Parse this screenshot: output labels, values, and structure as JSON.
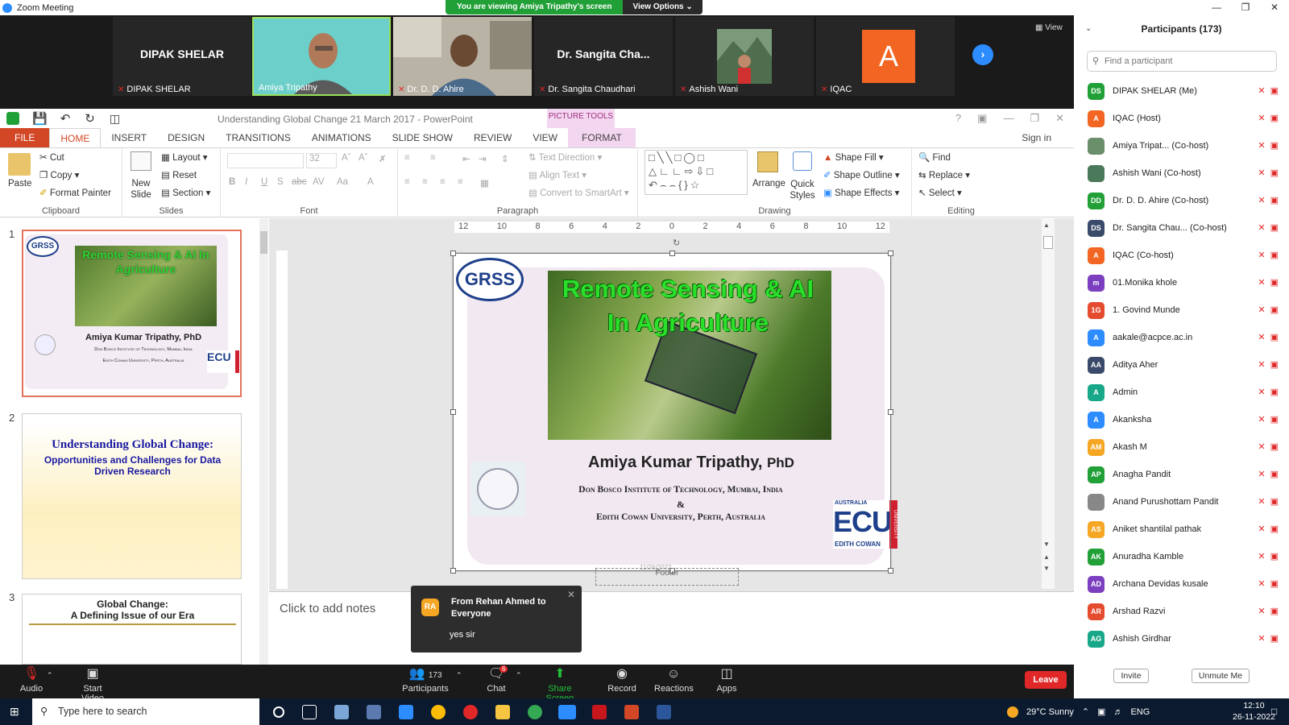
{
  "window": {
    "title": "Zoom Meeting"
  },
  "banner": {
    "message": "You are viewing Amiya Tripathy's screen",
    "view_options": "View Options ⌄"
  },
  "strip": {
    "tiles": [
      {
        "name": "DIPAK SHELAR",
        "display": "DIPAK SHELAR"
      },
      {
        "name": "Amiya  Tripathy"
      },
      {
        "name": "Dr. D. D. Ahire"
      },
      {
        "name": "Dr. Sangita Chaudhari",
        "display": "Dr. Sangita Cha..."
      },
      {
        "name": "Ashish Wani"
      },
      {
        "name": "IQAC",
        "initial": "A"
      }
    ],
    "view_label": "View"
  },
  "ppt": {
    "doc_title": "Understanding Global Change 21 March 2017 - PowerPoint",
    "picture_tools": "PICTURE TOOLS",
    "sign_in": "Sign in",
    "tabs": [
      "FILE",
      "HOME",
      "INSERT",
      "DESIGN",
      "TRANSITIONS",
      "ANIMATIONS",
      "SLIDE SHOW",
      "REVIEW",
      "VIEW",
      "FORMAT"
    ],
    "ribbon": {
      "clipboard": {
        "label": "Clipboard",
        "paste": "Paste",
        "cut": "Cut",
        "copy": "Copy",
        "format_painter": "Format Painter"
      },
      "slides": {
        "label": "Slides",
        "new_slide": "New Slide",
        "layout": "Layout",
        "reset": "Reset",
        "section": "Section"
      },
      "font": {
        "label": "Font",
        "size": "32"
      },
      "paragraph": {
        "label": "Paragraph",
        "text_direction": "Text Direction",
        "align_text": "Align Text",
        "convert": "Convert to SmartArt"
      },
      "drawing": {
        "label": "Drawing",
        "arrange": "Arrange",
        "quick_styles": "Quick Styles",
        "shape_fill": "Shape Fill",
        "shape_outline": "Shape Outline",
        "shape_effects": "Shape Effects"
      },
      "editing": {
        "label": "Editing",
        "find": "Find",
        "replace": "Replace",
        "select": "Select"
      }
    },
    "thumbs": [
      {
        "num": "1",
        "title": "Remote Sensing & AI In Agriculture",
        "author": "Amiya Kumar Tripathy, PhD",
        "inst1": "Don Bosco Institute of Technology, Mumbai, India",
        "inst2": "Edith Cowan University, Perth, Australia"
      },
      {
        "num": "2",
        "title": "Understanding Global Change:",
        "subtitle": "Opportunities and Challenges for Data Driven Research"
      },
      {
        "num": "3",
        "title": "Global Change:",
        "subtitle": "A Defining Issue of our Era"
      }
    ],
    "ruler_ticks": [
      "12",
      "10",
      "8",
      "6",
      "4",
      "2",
      "0",
      "2",
      "4",
      "6",
      "8",
      "10",
      "12"
    ],
    "slide": {
      "logo": "GRSS",
      "title_line1": "Remote Sensing & AI",
      "title_line2": "In Agriculture",
      "author": "Amiya Kumar Tripathy,",
      "author_suffix": "PhD",
      "inst1": "Don Bosco Institute of Technology, Mumbai, India",
      "amp": "&",
      "inst2": "Edith Cowan University, Perth, Australia",
      "ecu": "ECU",
      "ecu_sub": "EDITH COWAN",
      "ecu_side": "UNIVERSITY",
      "ecu_top": "AUSTRALIA",
      "date": "11/26/2022",
      "footer": "Footer"
    },
    "notes_placeholder": "Click to add notes"
  },
  "chat_popup": {
    "initials": "RA",
    "from": "From Rehan Ahmed to Everyone",
    "message": "yes sir"
  },
  "toolbar": {
    "audio": "Audio",
    "start_video": "Start Video",
    "participants": "Participants",
    "participants_count": "173",
    "chat": "Chat",
    "chat_badge": "6",
    "share_screen": "Share Screen",
    "record": "Record",
    "reactions": "Reactions",
    "apps": "Apps",
    "leave": "Leave"
  },
  "participants": {
    "title": "Participants (173)",
    "search_placeholder": "Find a participant",
    "list": [
      {
        "initials": "DS",
        "name": "DIPAK SHELAR (Me)",
        "color": "#21a038"
      },
      {
        "initials": "A",
        "name": "IQAC (Host)",
        "color": "#f26522"
      },
      {
        "initials": "",
        "name": "Amiya  Tripat... (Co-host)",
        "color": "#6b8e6b"
      },
      {
        "initials": "",
        "name": "Ashish Wani (Co-host)",
        "color": "#4a7a5a"
      },
      {
        "initials": "DD",
        "name": "Dr. D. D. Ahire (Co-host)",
        "color": "#21a038"
      },
      {
        "initials": "DS",
        "name": "Dr. Sangita Chau... (Co-host)",
        "color": "#3a4a6a"
      },
      {
        "initials": "A",
        "name": "IQAC (Co-host)",
        "color": "#f26522"
      },
      {
        "initials": "m",
        "name": "01.Monika khole",
        "color": "#7b3fbf"
      },
      {
        "initials": "1G",
        "name": "1. Govind Munde",
        "color": "#e54b2f"
      },
      {
        "initials": "A",
        "name": "aakale@acpce.ac.in",
        "color": "#2d8cff"
      },
      {
        "initials": "AA",
        "name": "Aditya Aher",
        "color": "#3a4a6a"
      },
      {
        "initials": "A",
        "name": "Admin",
        "color": "#19a78a"
      },
      {
        "initials": "A",
        "name": "Akanksha",
        "color": "#2d8cff"
      },
      {
        "initials": "AM",
        "name": "Akash M",
        "color": "#f5a623"
      },
      {
        "initials": "AP",
        "name": "Anagha Pandit",
        "color": "#21a038"
      },
      {
        "initials": "",
        "name": "Anand Purushottam Pandit",
        "color": "#888888"
      },
      {
        "initials": "AS",
        "name": "Aniket shantilal pathak",
        "color": "#f5a623"
      },
      {
        "initials": "AK",
        "name": "Anuradha Kamble",
        "color": "#21a038"
      },
      {
        "initials": "AD",
        "name": "Archana Devidas kusale",
        "color": "#7b3fbf"
      },
      {
        "initials": "AR",
        "name": "Arshad Razvi",
        "color": "#e54b2f"
      },
      {
        "initials": "AG",
        "name": "Ashish Girdhar",
        "color": "#19a78a"
      }
    ],
    "invite": "Invite",
    "unmute_me": "Unmute Me"
  },
  "taskbar": {
    "search_placeholder": "Type here to search",
    "weather": "29°C  Sunny",
    "lang": "ENG",
    "time": "12:10",
    "date": "26-11-2022"
  }
}
